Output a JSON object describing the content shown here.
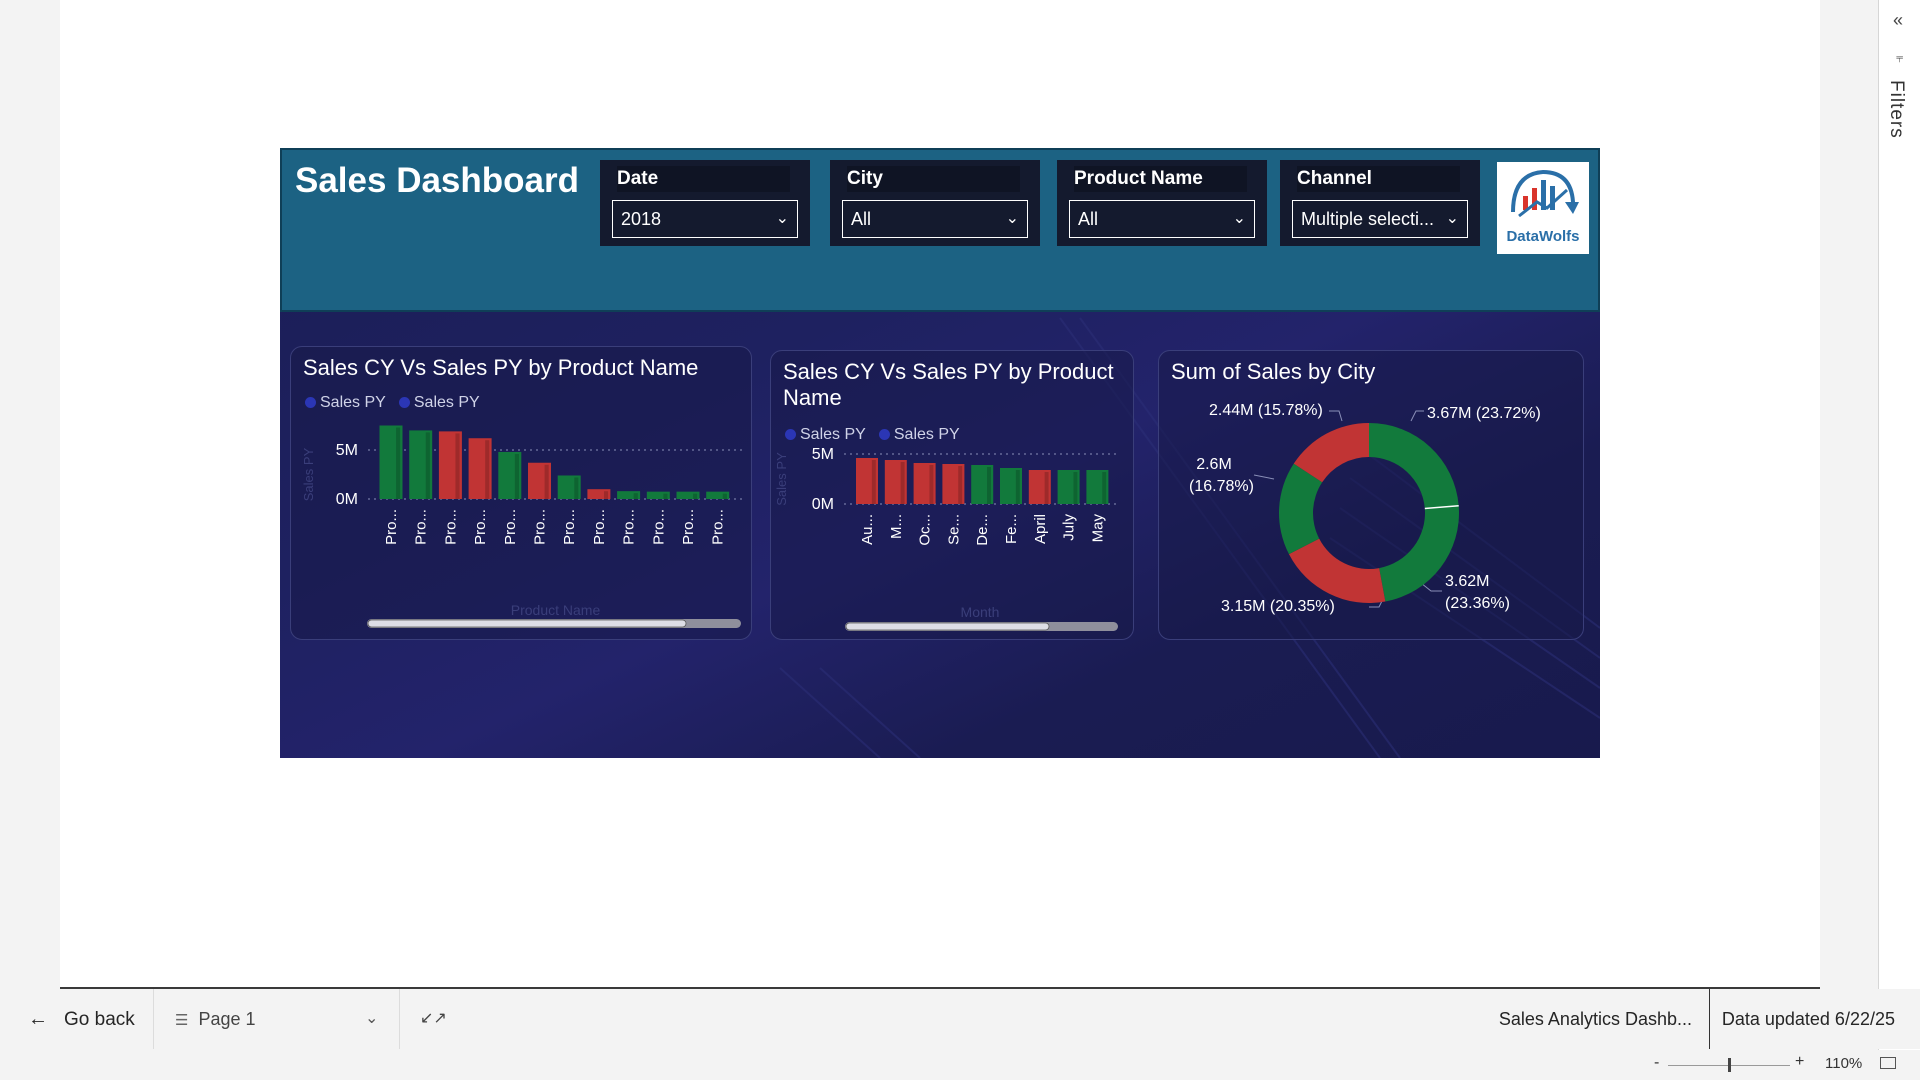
{
  "filters_pane": {
    "label": "Filters",
    "expand_icon": "double-chevron-left-icon",
    "funnel_icon": "filter-icon"
  },
  "header": {
    "title": "Sales Dashboard",
    "slicers": [
      {
        "label": "Date",
        "value": "2018"
      },
      {
        "label": "City",
        "value": "All"
      },
      {
        "label": "Product Name",
        "value": "All"
      },
      {
        "label": "Channel",
        "value": "Multiple selecti..."
      }
    ],
    "logo_text": "DataWolfs"
  },
  "colors": {
    "green": "#127a3c",
    "red": "#c13434",
    "legend_dot": "#2b36b5",
    "header_bg": "#1c6283",
    "report_bg": "#1d1f5c"
  },
  "chart_data": [
    {
      "type": "bar",
      "title": "Sales CY Vs Sales PY by Product Name",
      "legend": [
        "Sales PY",
        "Sales PY"
      ],
      "ylabel": "Sales PY",
      "xlabel": "Product Name",
      "y_ticks": [
        "5M",
        "0M"
      ],
      "ylim": [
        0,
        8000000
      ],
      "categories": [
        "Pro...",
        "Pro...",
        "Pro...",
        "Pro...",
        "Pro...",
        "Pro...",
        "Pro...",
        "Pro...",
        "Pro...",
        "Pro...",
        "Pro...",
        "Pro..."
      ],
      "values": [
        7500000,
        7000000,
        6900000,
        6200000,
        4800000,
        3700000,
        2400000,
        1000000,
        800000,
        750000,
        750000,
        750000
      ],
      "bar_colors": [
        "green",
        "green",
        "red",
        "red",
        "green",
        "red",
        "green",
        "red",
        "green",
        "green",
        "green",
        "green"
      ]
    },
    {
      "type": "bar",
      "title": "Sales CY Vs Sales PY by Product Name",
      "legend": [
        "Sales PY",
        "Sales PY"
      ],
      "ylabel": "Sales PY",
      "xlabel": "Month",
      "y_ticks": [
        "5M",
        "0M"
      ],
      "ylim": [
        0,
        5000000
      ],
      "categories": [
        "Au...",
        "M...",
        "Oc...",
        "Se...",
        "De...",
        "Fe...",
        "April",
        "July",
        "May"
      ],
      "values": [
        4600000,
        4400000,
        4100000,
        4000000,
        3900000,
        3600000,
        3400000,
        3400000,
        3400000
      ],
      "bar_colors": [
        "red",
        "red",
        "red",
        "red",
        "green",
        "green",
        "red",
        "green",
        "green"
      ]
    },
    {
      "type": "pie",
      "variant": "donut",
      "title": "Sum of Sales by City",
      "slices": [
        {
          "label_value": "3.67M (23.72%)",
          "value": 3.67,
          "color": "green"
        },
        {
          "label_value": "3.62M (23.36%)",
          "value": 3.62,
          "color": "green"
        },
        {
          "label_value": "3.15M (20.35%)",
          "value": 3.15,
          "color": "red"
        },
        {
          "label_value": "2.6M (16.78%)",
          "value": 2.6,
          "color": "green"
        },
        {
          "label_value": "2.44M (15.78%)",
          "value": 2.44,
          "color": "red"
        }
      ],
      "labels_display": {
        "top_right": "3.67M (23.72%)",
        "bottom_right_1": "3.62M",
        "bottom_right_2": "(23.36%)",
        "bottom_left": "3.15M (20.35%)",
        "left_1": "2.6M",
        "left_2": "(16.78%)",
        "top_left": "2.44M (15.78%)"
      }
    }
  ],
  "footer": {
    "go_back": "Go back",
    "page": "Page 1",
    "report_name": "Sales Analytics Dashb...",
    "data_updated": "Data updated 6/22/25"
  },
  "zoom": {
    "minus": "-",
    "plus": "+",
    "percent": "110%"
  }
}
